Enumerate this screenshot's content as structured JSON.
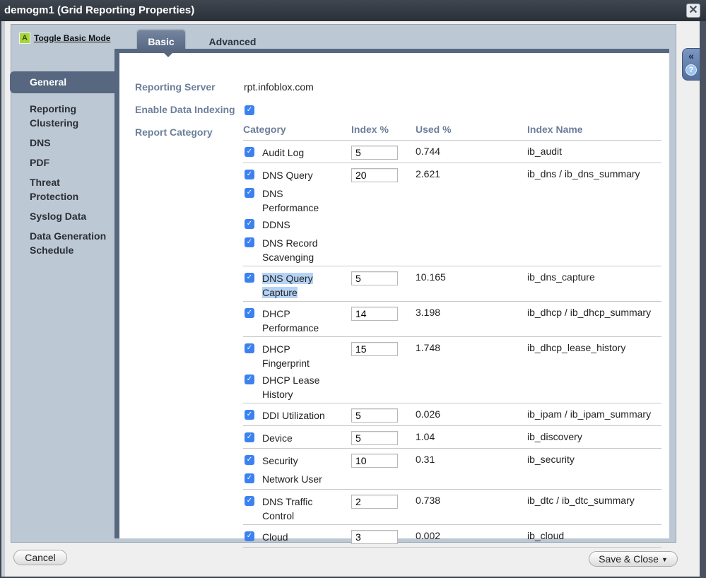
{
  "window": {
    "title": "demogm1 (Grid Reporting Properties)",
    "close_label": "✕"
  },
  "toggle": {
    "badge": "A",
    "label": "Toggle Basic Mode"
  },
  "tabs": [
    {
      "label": "Basic",
      "active": true
    },
    {
      "label": "Advanced",
      "active": false
    }
  ],
  "sidebar": {
    "items": [
      {
        "label": "General",
        "active": true
      },
      {
        "label": "Reporting Clustering"
      },
      {
        "label": "DNS"
      },
      {
        "label": "PDF"
      },
      {
        "label": "Threat Protection"
      },
      {
        "label": "Syslog Data"
      },
      {
        "label": "Data Generation Schedule"
      }
    ]
  },
  "form": {
    "reporting_server_label": "Reporting Server",
    "reporting_server_value": "rpt.infoblox.com",
    "enable_indexing_label": "Enable Data Indexing",
    "enable_indexing_checked": true,
    "report_category_label": "Report Category"
  },
  "table": {
    "headers": {
      "category": "Category",
      "index": "Index %",
      "used": "Used %",
      "name": "Index Name"
    },
    "groups": [
      {
        "index": "5",
        "used": "0.744",
        "name": "ib_audit",
        "categories": [
          "Audit Log"
        ]
      },
      {
        "index": "20",
        "used": "2.621",
        "name": "ib_dns / ib_dns_summary",
        "categories": [
          "DNS Query",
          "DNS Performance",
          "DDNS",
          "DNS Record Scavenging"
        ]
      },
      {
        "index": "5",
        "used": "10.165",
        "name": "ib_dns_capture",
        "categories": [
          "DNS Query Capture"
        ],
        "selected": true
      },
      {
        "index": "14",
        "used": "3.198",
        "name": "ib_dhcp / ib_dhcp_summary",
        "categories": [
          "DHCP Performance"
        ]
      },
      {
        "index": "15",
        "used": "1.748",
        "name": "ib_dhcp_lease_history",
        "categories": [
          "DHCP Fingerprint",
          "DHCP Lease History"
        ]
      },
      {
        "index": "5",
        "used": "0.026",
        "name": "ib_ipam / ib_ipam_summary",
        "categories": [
          "DDI Utilization"
        ]
      },
      {
        "index": "5",
        "used": "1.04",
        "name": "ib_discovery",
        "categories": [
          "Device"
        ]
      },
      {
        "index": "10",
        "used": "0.31",
        "name": "ib_security",
        "categories": [
          "Security",
          "Network User"
        ]
      },
      {
        "index": "2",
        "used": "0.738",
        "name": "ib_dtc / ib_dtc_summary",
        "categories": [
          "DNS Traffic Control"
        ]
      },
      {
        "index": "3",
        "used": "0.002",
        "name": "ib_cloud",
        "categories": [
          "Cloud"
        ]
      }
    ]
  },
  "side_tools": {
    "collapse": "«",
    "help": "?"
  },
  "footer": {
    "cancel_label": "Cancel",
    "save_label": "Save & Close",
    "save_caret": "▼"
  },
  "checkbox_glyph": "✓"
}
